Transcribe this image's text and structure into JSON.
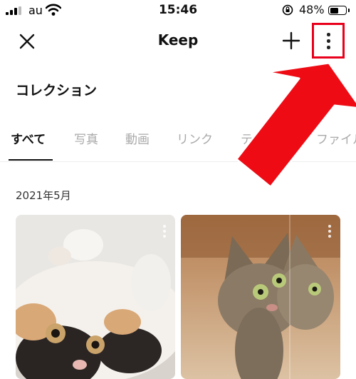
{
  "status_bar": {
    "carrier": "au",
    "time": "15:46",
    "battery_percent": "48%",
    "battery_level": 0.48,
    "icons": [
      "signal-icon",
      "wifi-icon",
      "rotation-lock-icon",
      "battery-icon"
    ]
  },
  "header": {
    "title": "Keep",
    "icons": [
      "close-icon",
      "plus-icon",
      "more-vertical-icon"
    ],
    "highlight_color": "#e8001c"
  },
  "collection": {
    "label": "コレクション",
    "icon": "chevron-down-icon"
  },
  "tabs": [
    {
      "label": "すべて",
      "active": true
    },
    {
      "label": "写真",
      "active": false
    },
    {
      "label": "動画",
      "active": false
    },
    {
      "label": "リンク",
      "active": false
    },
    {
      "label": "テキスト",
      "active": false
    },
    {
      "label": "ファイル",
      "active": false
    }
  ],
  "content": {
    "section_date": "2021年5月",
    "items": [
      {
        "kind": "photo",
        "subject": "calico-cat",
        "icon": "more-vertical-icon"
      },
      {
        "kind": "photo",
        "subject": "tabby-cat-mirror",
        "icon": "more-vertical-icon"
      }
    ]
  },
  "annotation": {
    "type": "arrow",
    "color": "#ee0b14",
    "points_to": "more-button"
  }
}
